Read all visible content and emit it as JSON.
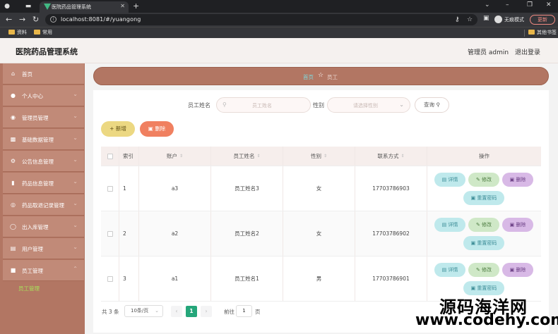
{
  "browser": {
    "tab_title": "医院药品管理系统",
    "url": "localhost:8081/#/yuangong",
    "incognito_label": "无痕模式",
    "update_label": "更新",
    "bookmarks": [
      "资料",
      "常用"
    ],
    "bookmarks_right": "其他书签"
  },
  "header": {
    "title": "医院药品管理系统",
    "admin": "管理员 admin",
    "logout": "退出登录"
  },
  "sidebar": {
    "items": [
      {
        "label": "首页",
        "icon": "home-icon"
      },
      {
        "label": "个人中心",
        "icon": "user-icon"
      },
      {
        "label": "管理员管理",
        "icon": "admin-icon"
      },
      {
        "label": "基础数据管理",
        "icon": "database-icon"
      },
      {
        "label": "公告信息管理",
        "icon": "notice-icon"
      },
      {
        "label": "药品信息管理",
        "icon": "chart-icon"
      },
      {
        "label": "药品取退记录管理",
        "icon": "record-icon"
      },
      {
        "label": "出入库管理",
        "icon": "warehouse-icon"
      },
      {
        "label": "用户管理",
        "icon": "users-icon"
      },
      {
        "label": "员工管理",
        "icon": "staff-icon"
      }
    ],
    "sub_item": "员工管理"
  },
  "breadcrumb": {
    "home": "首页",
    "current": "员工"
  },
  "search": {
    "name_label": "员工姓名",
    "name_placeholder": "员工姓名",
    "sex_label": "性别",
    "sex_placeholder": "请选择性别",
    "query_label": "查询"
  },
  "toolbar": {
    "add_label": "新增",
    "delete_label": "删除"
  },
  "table": {
    "headers": {
      "index": "索引",
      "account": "账户",
      "name": "员工姓名",
      "sex": "性别",
      "phone": "联系方式",
      "action": "操作"
    },
    "rows": [
      {
        "index": "1",
        "account": "a3",
        "name": "员工姓名3",
        "sex": "女",
        "phone": "17703786903"
      },
      {
        "index": "2",
        "account": "a2",
        "name": "员工姓名2",
        "sex": "女",
        "phone": "17703786902"
      },
      {
        "index": "3",
        "account": "a1",
        "name": "员工姓名1",
        "sex": "男",
        "phone": "17703786901"
      }
    ],
    "actions": {
      "detail": "详情",
      "edit": "修改",
      "remove": "删除",
      "reset": "重置密码"
    }
  },
  "pagination": {
    "total": "共 3 条",
    "page_size": "10条/页",
    "current_page": "1",
    "goto_label": "前往",
    "goto_value": "1",
    "page_unit": "页"
  },
  "watermark": {
    "line1": "源码海洋网",
    "line2": "www.codehy.com"
  }
}
